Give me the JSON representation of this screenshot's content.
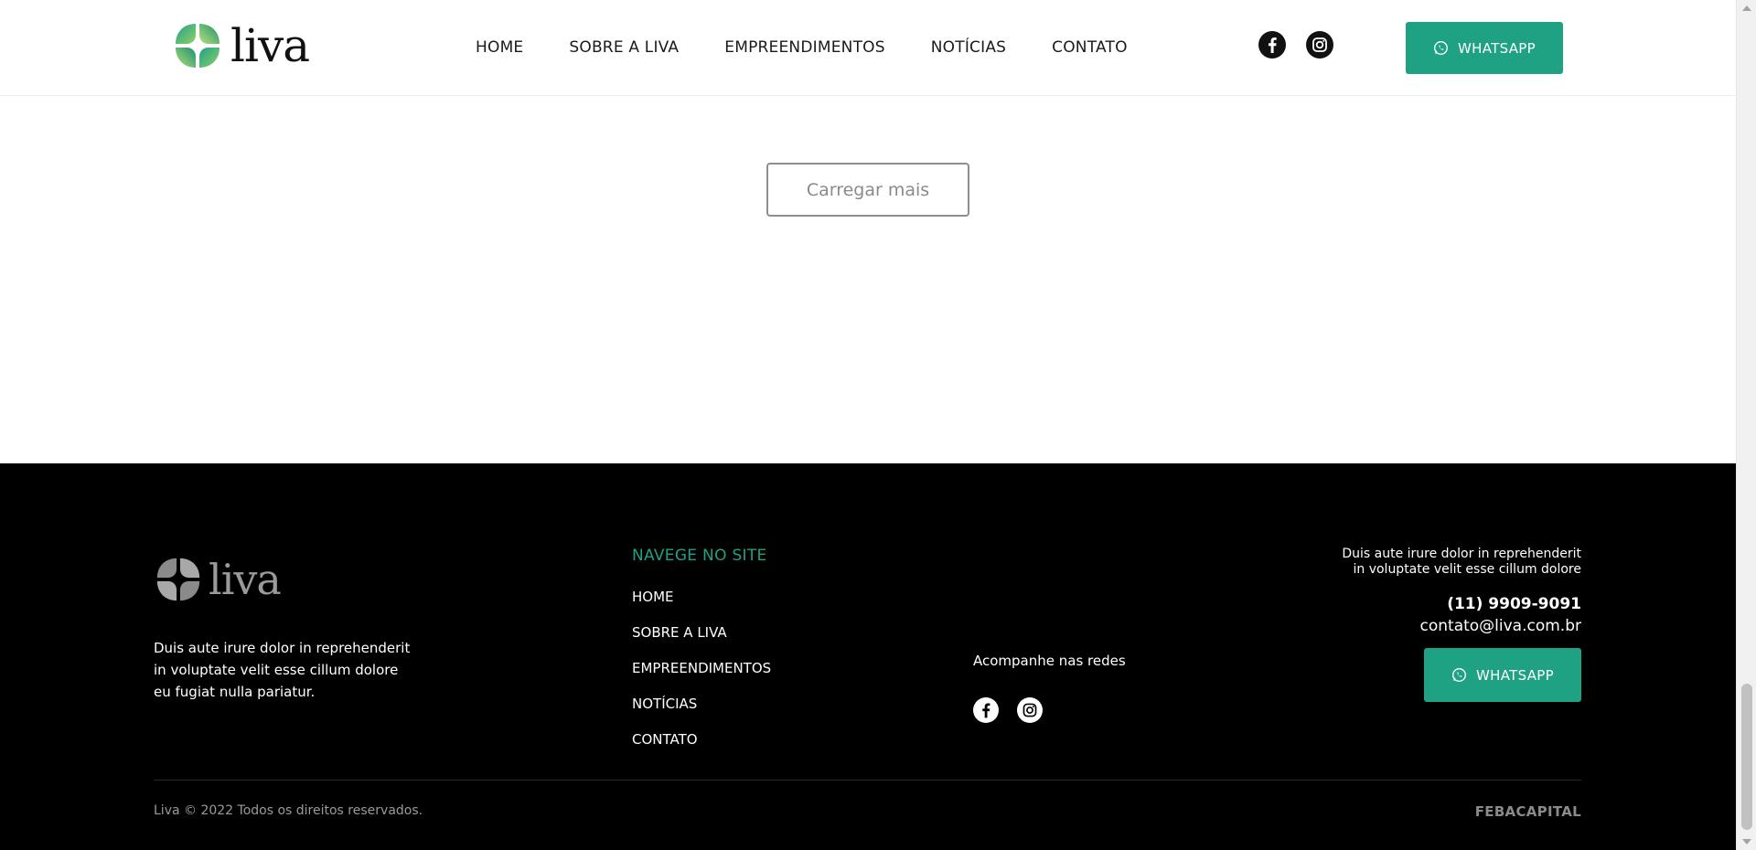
{
  "header": {
    "logo_text": "liva",
    "nav": [
      "HOME",
      "SOBRE A LIVA",
      "EMPREENDIMENTOS",
      "NOTÍCIAS",
      "CONTATO"
    ],
    "whatsapp_label": "WHATSAPP"
  },
  "main": {
    "load_more_label": "Carregar mais"
  },
  "footer": {
    "logo_text": "liva",
    "description": "Duis aute irure dolor in reprehenderit in voluptate velit esse cillum dolore eu fugiat nulla pariatur.",
    "nav_title": "NAVEGE NO SITE",
    "nav": [
      "HOME",
      "SOBRE A LIVA",
      "EMPREENDIMENTOS",
      "NOTÍCIAS",
      "CONTATO"
    ],
    "follow_label": "Acompanhe nas redes",
    "right_description": "Duis aute irure dolor in reprehenderit in voluptate velit esse cillum dolore",
    "phone": "(11) 9909-9091",
    "email": "contato@liva.com.br",
    "whatsapp_label": "WHATSAPP",
    "copyright": "Liva © 2022 Todos os direitos reservados.",
    "brand": "FEBACAPITAL"
  },
  "colors": {
    "accent": "#1fa184",
    "footer_bg": "#000000"
  },
  "icons": [
    "clover-logo-icon",
    "facebook-icon",
    "instagram-icon",
    "whatsapp-icon"
  ]
}
